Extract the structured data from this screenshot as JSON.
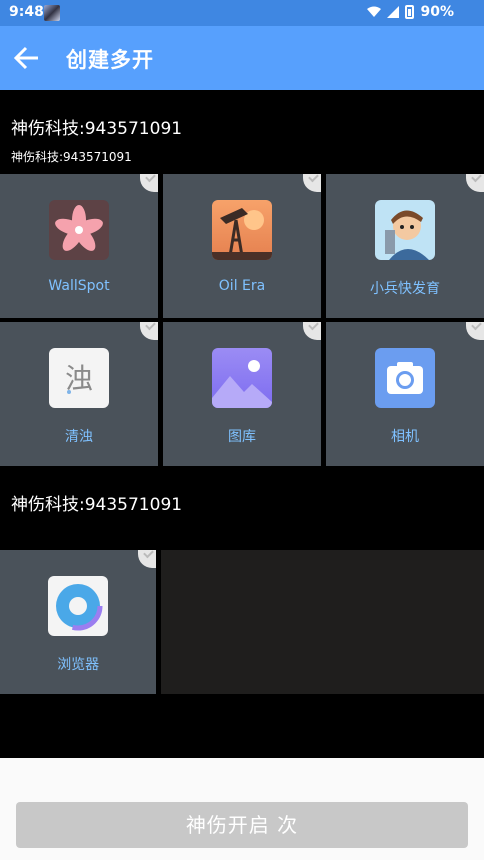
{
  "status_bar": {
    "time": "9:48",
    "battery": "90%"
  },
  "app_bar": {
    "title": "创建多开"
  },
  "groups": [
    {
      "title": "神伤科技:943571091",
      "subtitle": "神伤科技:943571091"
    },
    {
      "title": "神伤科技:943571091"
    }
  ],
  "apps": [
    {
      "label": "WallSpot",
      "icon": "wallspot-icon"
    },
    {
      "label": "Oil Era",
      "icon": "oil-era-icon"
    },
    {
      "label": "小兵快发育",
      "icon": "soldier-game-icon"
    },
    {
      "label": "清浊",
      "icon": "qingzhuo-icon"
    },
    {
      "label": "图库",
      "icon": "gallery-icon"
    },
    {
      "label": "相机",
      "icon": "camera-icon"
    },
    {
      "label": "浏览器",
      "icon": "browser-icon"
    }
  ],
  "footer": {
    "button_label": "神伤开启 次"
  },
  "colors": {
    "app_bar": "#57a0fd",
    "status_bar": "#3f87e2",
    "tile": "#4a525a",
    "label": "#7fc1ff",
    "button_disabled": "#c8c8c8"
  }
}
